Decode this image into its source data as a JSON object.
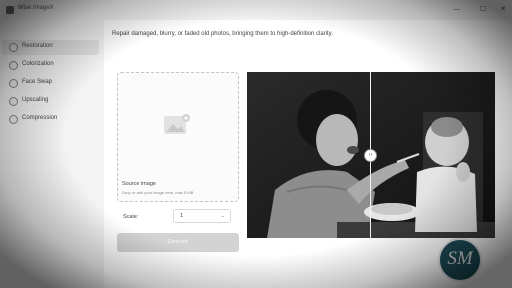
{
  "window": {
    "title": "Wise ImageX",
    "controls": {
      "minimize": "—",
      "maximize": "☐",
      "close": "✕"
    }
  },
  "sidebar": {
    "items": [
      {
        "label": "Restoration",
        "active": true
      },
      {
        "label": "Colorization",
        "active": false
      },
      {
        "label": "Face Swap",
        "active": false
      },
      {
        "label": "Upscaling",
        "active": false
      },
      {
        "label": "Compression",
        "active": false
      }
    ]
  },
  "main": {
    "description": "Repair damaged, blurry, or faded old photos, bringing them to high-definition clarity.",
    "dropzone": {
      "icon": "image-icon",
      "title": "Source image",
      "hint": "Drop or add your image here, max 5 MB"
    },
    "scale": {
      "label": "Scale:",
      "value": "1"
    },
    "generate_label": "Generate"
  },
  "preview": {
    "handle_glyph": "‹›",
    "icon": "compare-slider-icon"
  },
  "watermark": {
    "text": "SM"
  }
}
